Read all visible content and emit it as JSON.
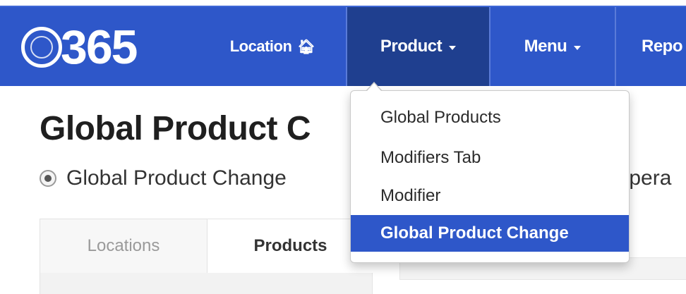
{
  "brand": {
    "logo_text": "365",
    "primary_color": "#2e57c9",
    "active_nav_color": "#1f3f8f"
  },
  "navbar": {
    "items": [
      {
        "label": "Location",
        "icon": "home-icon"
      },
      {
        "label": "Product",
        "icon": "caret-down-icon"
      },
      {
        "label": "Menu",
        "icon": "caret-down-icon"
      },
      {
        "label": "Repo"
      }
    ]
  },
  "page": {
    "title": "Global Product C",
    "radio_left_label": "Global Product Change",
    "radio_right_label": "Opera"
  },
  "tabs": [
    {
      "label": "Locations"
    },
    {
      "label": "Products"
    }
  ],
  "dropdown": {
    "items": [
      {
        "label": "Global Products"
      },
      {
        "label": "Modifiers Tab"
      },
      {
        "label": "Modifier"
      },
      {
        "label": "Global Product Change"
      }
    ],
    "selected": "Global Product Change"
  }
}
